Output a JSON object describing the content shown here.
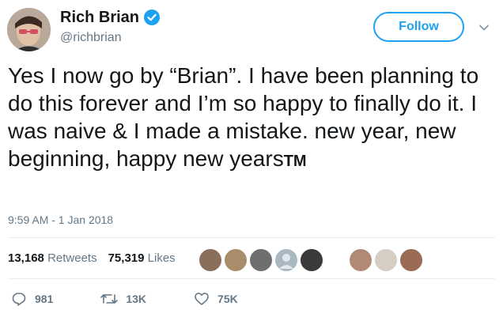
{
  "user": {
    "display_name": "Rich Brian",
    "handle": "@richbrian",
    "verified_icon": "verified-badge-icon"
  },
  "follow_button": {
    "label": "Follow"
  },
  "tweet": {
    "text_main": "Yes I now go by “Brian”. I have been planning to do this forever and I’m so happy to finally do it. I was naive & I made a mistake. new year, new beginning, happy new years",
    "text_suffix": "TM",
    "timestamp": "9:59 AM - 1 Jan 2018"
  },
  "stats": {
    "retweets_count": "13,168",
    "retweets_label": "Retweets",
    "likes_count": "75,319",
    "likes_label": "Likes"
  },
  "actions": {
    "reply_count": "981",
    "retweet_count": "13K",
    "like_count": "75K"
  },
  "colors": {
    "accent": "#1da1f2",
    "muted_text": "#657786",
    "divider": "#e6ecf0"
  }
}
